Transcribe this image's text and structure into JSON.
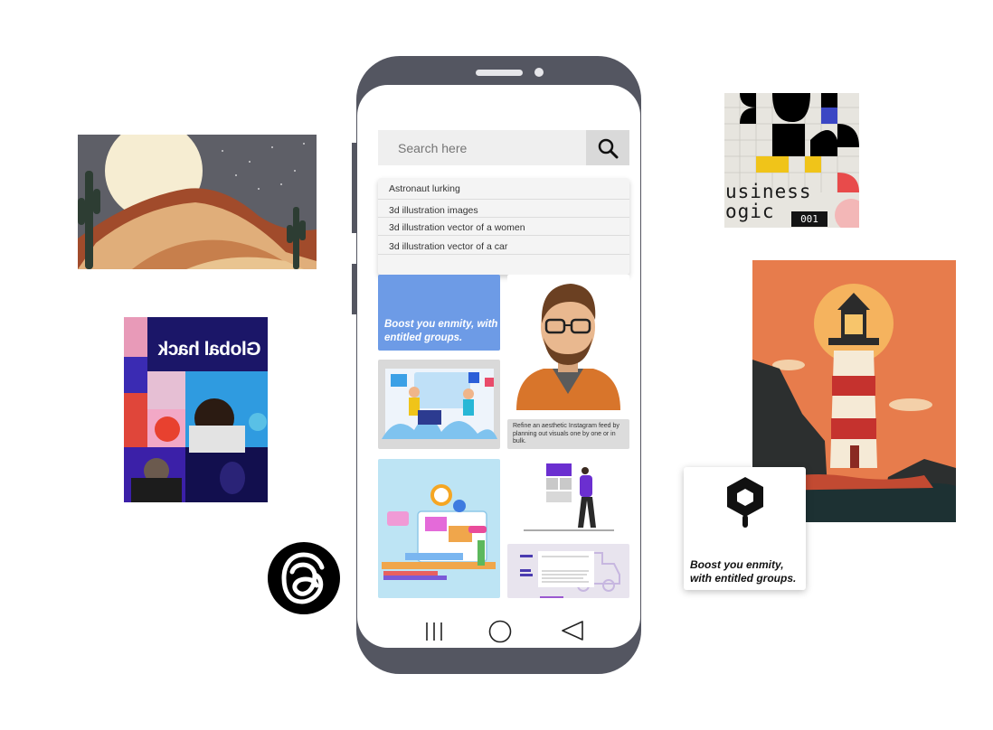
{
  "search": {
    "placeholder": "Search here",
    "icon": "search-icon",
    "suggestions": [
      "Astronaut lurking",
      "3d illustration images",
      "3d illustration vector of a women",
      "3d illustration vector of a car"
    ]
  },
  "tiles": {
    "boost_text": "Boost you enmity, with entitled groups.",
    "refine_text": "Refine an aesthetic Instagram feed by planning out visuals one by one or in bulk."
  },
  "cards": {
    "global_title": "Global hack",
    "business_title_line1": "usiness",
    "business_title_line2": "ogic",
    "business_number": "001",
    "boost_card_text": "Boost you enmity, with entitled groups."
  },
  "nav": {
    "recents_icon": "recents-icon",
    "home_icon": "home-icon",
    "back_icon": "back-icon"
  },
  "colors": {
    "phone_frame": "#545661",
    "boost_tile": "#6d9be6",
    "lighthouse_bg": "#e77c4c",
    "global_bg": "#1b1668"
  }
}
